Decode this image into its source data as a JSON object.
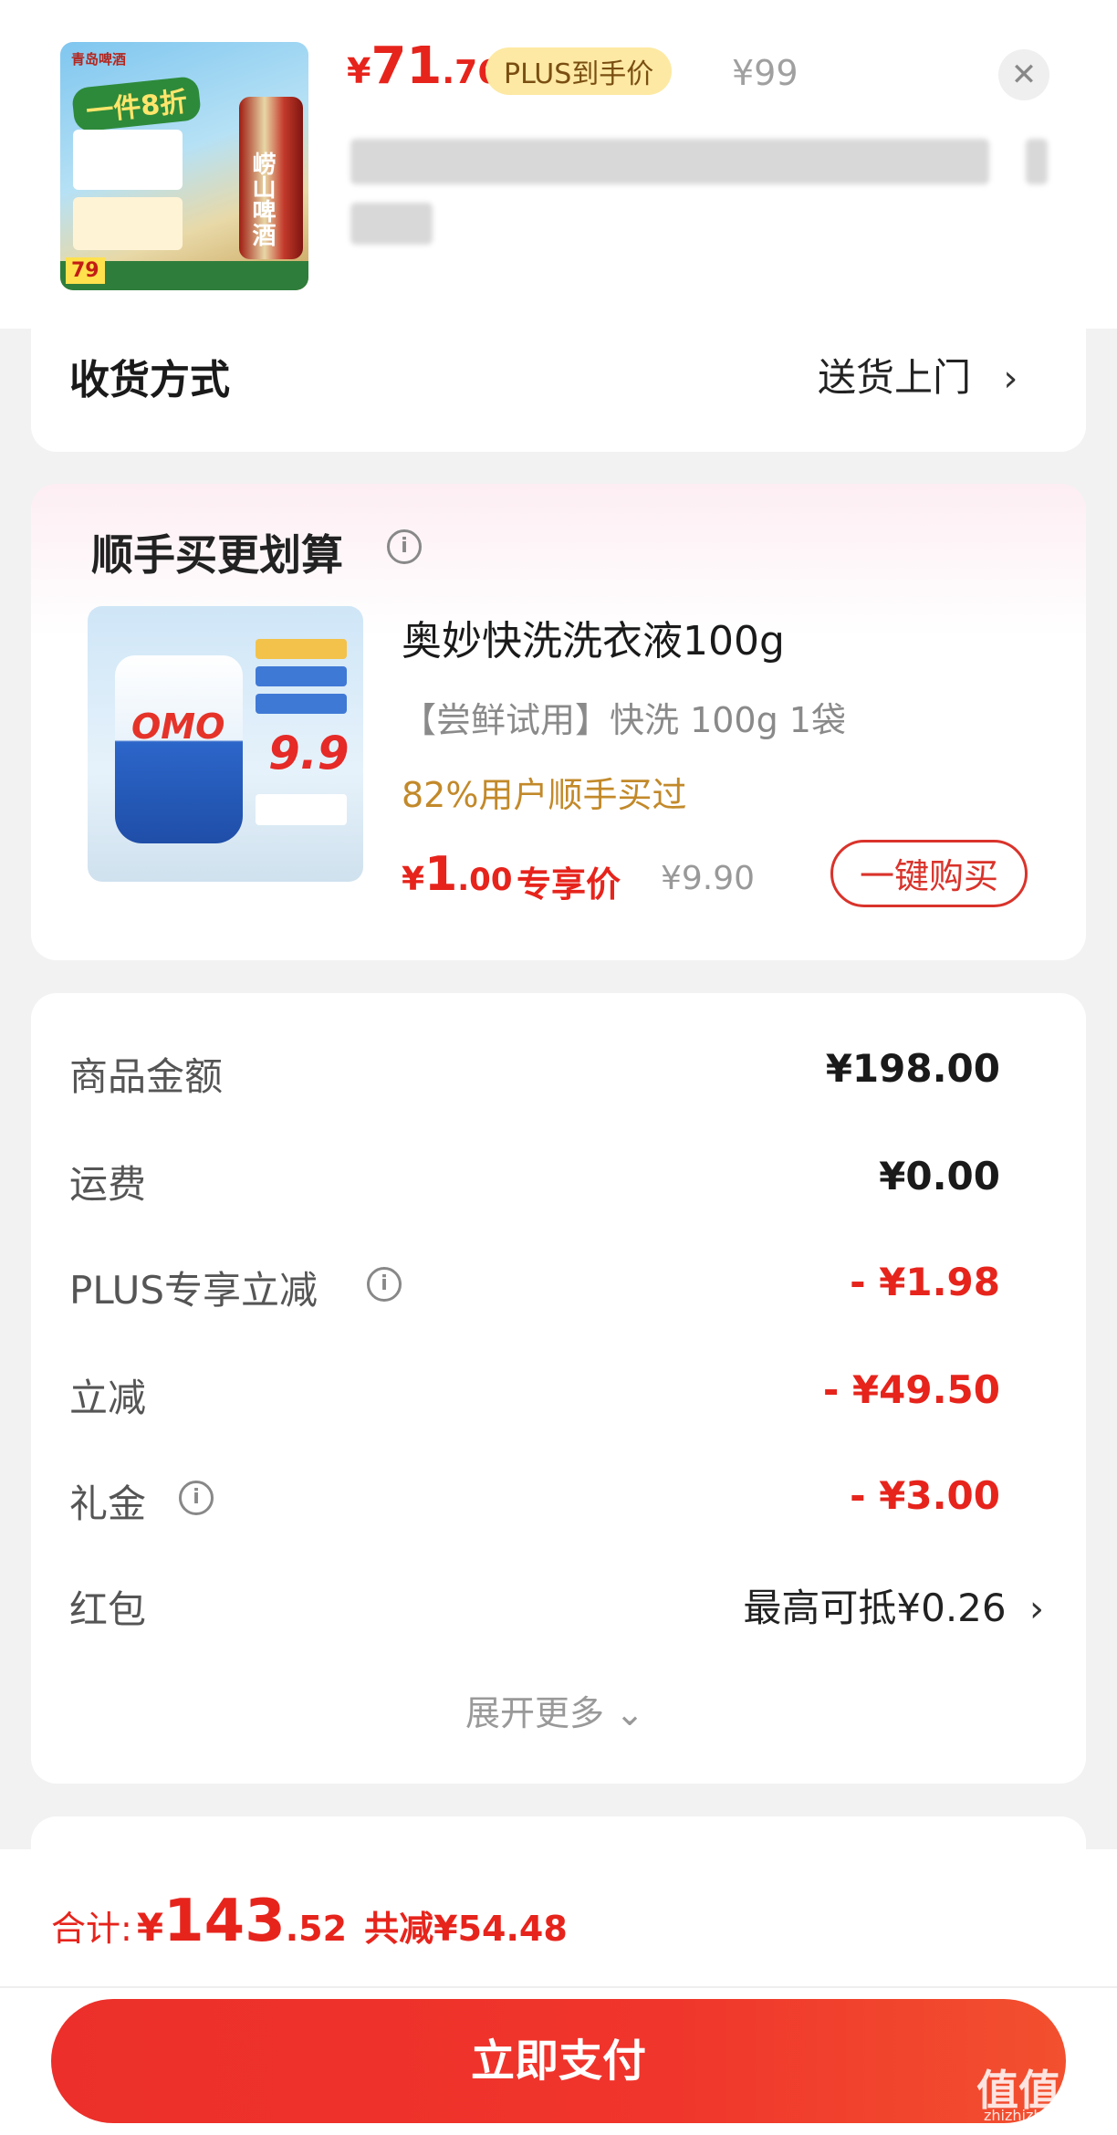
{
  "product": {
    "thumb_brand": "青岛啤酒",
    "thumb_badge": "一件8折",
    "thumb_can_label": "崂山啤酒",
    "thumb_price": "79",
    "price_symbol": "¥",
    "price_integer": "71",
    "price_decimal": ".76",
    "plus_label": "PLUS到手价",
    "original_price": "¥99",
    "close_icon": "close-icon"
  },
  "delivery": {
    "label": "收货方式",
    "value": "送货上门",
    "chevron": "›"
  },
  "recommendation": {
    "title": "顺手买更划算",
    "info_icon": "i",
    "thumb_logo": "OMO",
    "thumb_price": "9.9",
    "item_name": "奥妙快洗洗衣液100g",
    "item_spec": "【尝鲜试用】快洗 100g 1袋",
    "social_proof": "82%用户顺手买过",
    "price_symbol": "¥",
    "price_integer": "1",
    "price_decimal": ".00",
    "price_label": "专享价",
    "original_price": "¥9.90",
    "buy_button": "一键购买"
  },
  "summary": {
    "rows": [
      {
        "label": "商品金额",
        "value": "¥198.00"
      },
      {
        "label": "运费",
        "value": "¥0.00"
      },
      {
        "label": "PLUS专享立减",
        "value": "- ¥1.98"
      },
      {
        "label": "立减",
        "value": "- ¥49.50"
      },
      {
        "label": "礼金",
        "value": "- ¥3.00"
      },
      {
        "label": "红包",
        "value": "最高可抵¥0.26"
      }
    ],
    "info_icon": "i",
    "chevron": "›",
    "expand_more": "展开更多 ⌄"
  },
  "footer": {
    "total_label": "合计:",
    "total_symbol": "¥",
    "total_integer": "143",
    "total_decimal": ".52",
    "total_saving": "共减¥54.48",
    "pay_button": "立即支付",
    "watermark": "值值值",
    "watermark_sub": "zhizhizhi.com"
  },
  "colors": {
    "accent_red": "#e6241c",
    "plus_gold": "#fde9a3",
    "social_orange": "#c2892a"
  }
}
